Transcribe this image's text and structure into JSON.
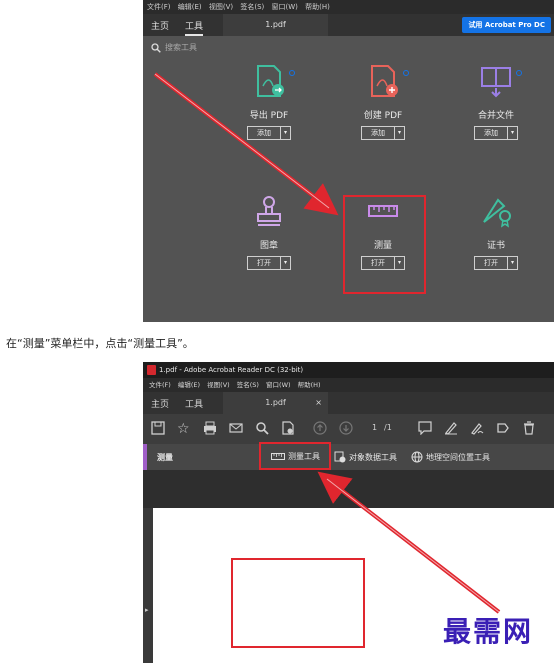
{
  "screenshot1": {
    "menu": [
      "文件(F)",
      "编辑(E)",
      "视图(V)",
      "签名(S)",
      "窗口(W)",
      "帮助(H)"
    ],
    "tabs": {
      "home": "主页",
      "tools": "工具",
      "document": "1.pdf"
    },
    "try_button": "试用 Acrobat Pro DC",
    "search_placeholder": "搜索工具",
    "tools": [
      {
        "label": "导出 PDF",
        "button": "添加",
        "icon": "export-pdf-icon"
      },
      {
        "label": "创建 PDF",
        "button": "添加",
        "icon": "create-pdf-icon"
      },
      {
        "label": "合并文件",
        "button": "添加",
        "icon": "combine-files-icon"
      },
      {
        "label": "图章",
        "button": "打开",
        "icon": "stamp-icon"
      },
      {
        "label": "测量",
        "button": "打开",
        "icon": "ruler-icon"
      },
      {
        "label": "证书",
        "button": "打开",
        "icon": "certificate-icon"
      }
    ],
    "colors": {
      "background": "#535353",
      "accent": "#1473e6",
      "highlight": "#e0262e"
    }
  },
  "caption": "在“测量”菜单栏中，点击“测量工具”。",
  "screenshot2": {
    "window_title": "1.pdf - Adobe Acrobat Reader DC (32-bit)",
    "menu": [
      "文件(F)",
      "编辑(E)",
      "视图(V)",
      "签名(S)",
      "窗口(W)",
      "帮助(H)"
    ],
    "tabs": {
      "home": "主页",
      "tools": "工具",
      "document": "1.pdf",
      "close": "×"
    },
    "page_current": "1",
    "page_total": "/1",
    "toolbar_title": "测量",
    "measure_tools": [
      "测量工具",
      "对象数据工具",
      "地理空间位置工具"
    ]
  },
  "watermark": "最需网"
}
